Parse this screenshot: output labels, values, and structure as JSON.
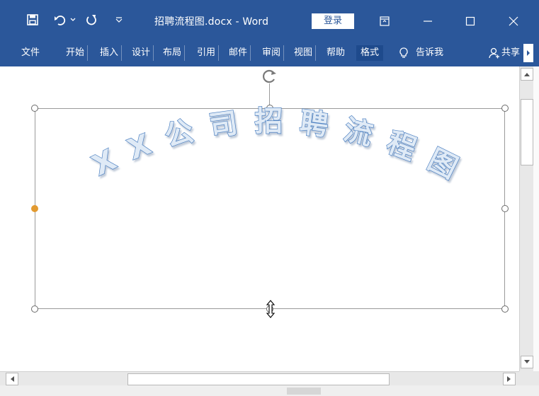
{
  "titlebar": {
    "doc_title": "招聘流程图.docx  -  Word",
    "login_label": "登录"
  },
  "ribbon": {
    "tabs": [
      {
        "label": "文件"
      },
      {
        "label": "开始"
      },
      {
        "label": "插入"
      },
      {
        "label": "设计"
      },
      {
        "label": "布局"
      },
      {
        "label": "引用"
      },
      {
        "label": "邮件"
      },
      {
        "label": "审阅"
      },
      {
        "label": "视图"
      },
      {
        "label": "帮助"
      },
      {
        "label": "格式"
      }
    ],
    "tell_me": "告诉我",
    "share": "共享"
  },
  "document": {
    "wordart_text": "XX公司招聘流程图"
  },
  "colors": {
    "title_bg": "#2b579a",
    "wordart_fill": "#cfe0f2",
    "wordart_stroke": "#4a7fc0",
    "handle_orange": "#e29a30"
  }
}
